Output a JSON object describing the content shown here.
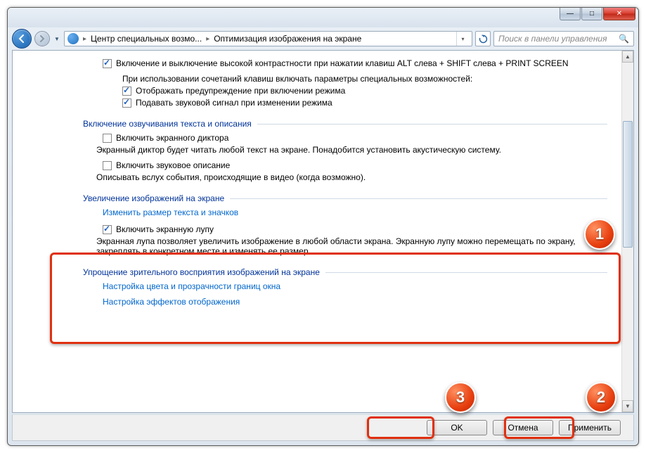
{
  "titlebar": {
    "minimize_icon": "—",
    "maximize_icon": "□",
    "close_icon": "✕"
  },
  "address": {
    "crumb1": "Центр специальных возмо...",
    "crumb2": "Оптимизация изображения на экране",
    "search_placeholder": "Поиск в панели управления"
  },
  "content": {
    "opt1": "Включение и выключение высокой контрастности при нажатии клавиш ALT слева + SHIFT слева + PRINT SCREEN",
    "opt1_sub": "При использовании сочетаний клавиш включать параметры специальных возможностей:",
    "opt1_a": "Отображать предупреждение при включении режима",
    "opt1_b": "Подавать звуковой сигнал при изменении режима",
    "section_narration": "Включение озвучивания текста и описания",
    "narrator_cb": "Включить экранного диктора",
    "narrator_desc": "Экранный диктор будет читать любой текст на экране. Понадобится установить акустическую систему.",
    "audio_cb": "Включить звуковое описание",
    "audio_desc": "Описывать вслух события, происходящие в видео (когда возможно).",
    "section_magnify": "Увеличение изображений на экране",
    "resize_link": "Изменить размер текста и значков",
    "magnifier_cb": "Включить экранную лупу",
    "magnifier_desc": "Экранная лупа позволяет увеличить изображение в любой области экрана. Экранную лупу можно перемещать по экрану, закреплять в конкретном месте и изменять ее размер.",
    "section_simplify": "Упрощение зрительного восприятия изображений на экране",
    "color_link": "Настройка цвета и прозрачности границ окна",
    "effects_link": "Настройка эффектов отображения"
  },
  "buttons": {
    "ok": "OK",
    "cancel": "Отмена",
    "apply": "Применить"
  },
  "markers": {
    "m1": "1",
    "m2": "2",
    "m3": "3"
  }
}
